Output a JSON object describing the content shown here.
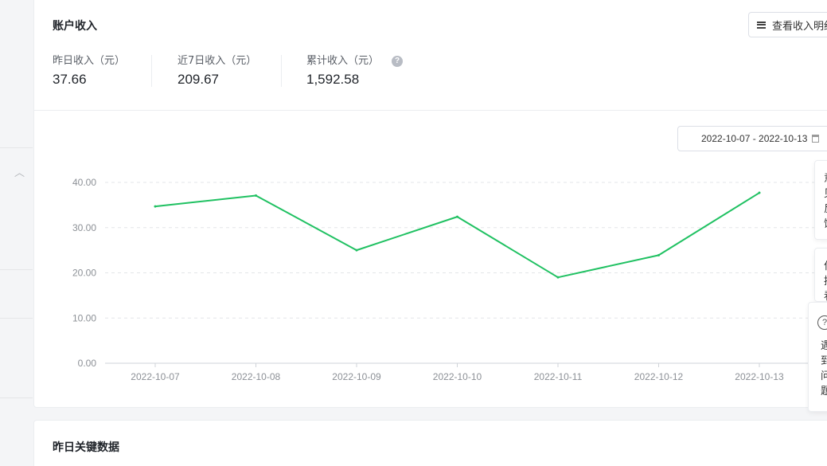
{
  "income_card": {
    "title": "账户收入",
    "detail_button_label": "查看收入明细",
    "stats": [
      {
        "label": "昨日收入（元）",
        "value": "37.66"
      },
      {
        "label": "近7日收入（元）",
        "value": "209.67"
      },
      {
        "label": "累计收入（元）",
        "value": "1,592.58"
      }
    ],
    "help_icon": "question-circle-icon",
    "date_range": "2022-10-07 - 2022-10-13"
  },
  "chart_data": {
    "type": "line",
    "x": [
      "2022-10-07",
      "2022-10-08",
      "2022-10-09",
      "2022-10-10",
      "2022-10-11",
      "2022-10-12",
      "2022-10-13"
    ],
    "series": [
      {
        "values": [
          34.7,
          37.1,
          25.0,
          32.4,
          19.0,
          23.9,
          37.7
        ],
        "color": "#20c162"
      }
    ],
    "y_ticks": [
      "0.00",
      "10.00",
      "20.00",
      "30.00",
      "40.00"
    ],
    "ylim": [
      0,
      40
    ],
    "grid": true,
    "grid_style": "dashed"
  },
  "key_card": {
    "title": "昨日关键数据"
  },
  "side_panels": [
    {
      "chars": [
        "意",
        "见",
        "反",
        "馈"
      ]
    },
    {
      "chars": [
        "作",
        "控",
        "看"
      ]
    },
    {
      "icon": "question-icon",
      "chars": [
        "遇",
        "到",
        "问",
        "题"
      ]
    }
  ]
}
